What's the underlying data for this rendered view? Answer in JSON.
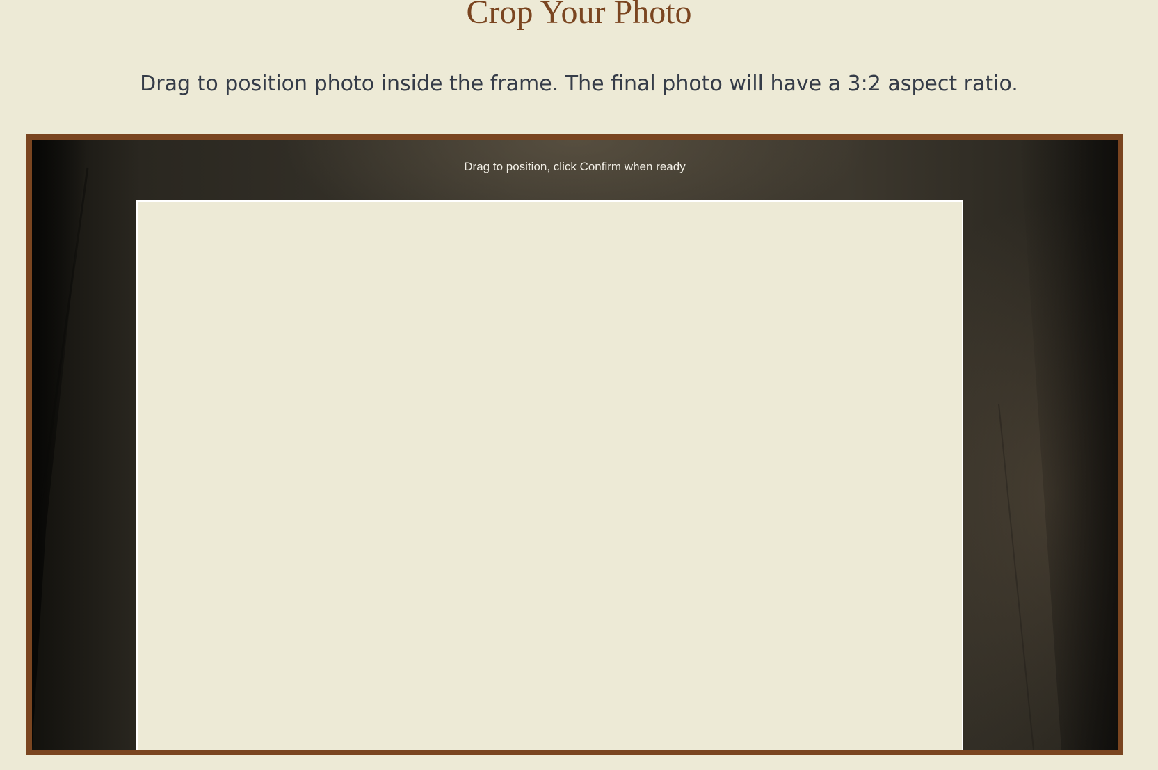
{
  "header": {
    "title": "Crop Your Photo",
    "instructions": "Drag to position photo inside the frame. The final photo will have a 3:2 aspect ratio."
  },
  "cropper": {
    "hint": "Drag to position, click Confirm when ready",
    "aspect_ratio": "3:2"
  },
  "colors": {
    "page_background": "#edead6",
    "accent_brown": "#7a4520",
    "text_dark": "#353c48",
    "crop_border": "#ffffff"
  }
}
